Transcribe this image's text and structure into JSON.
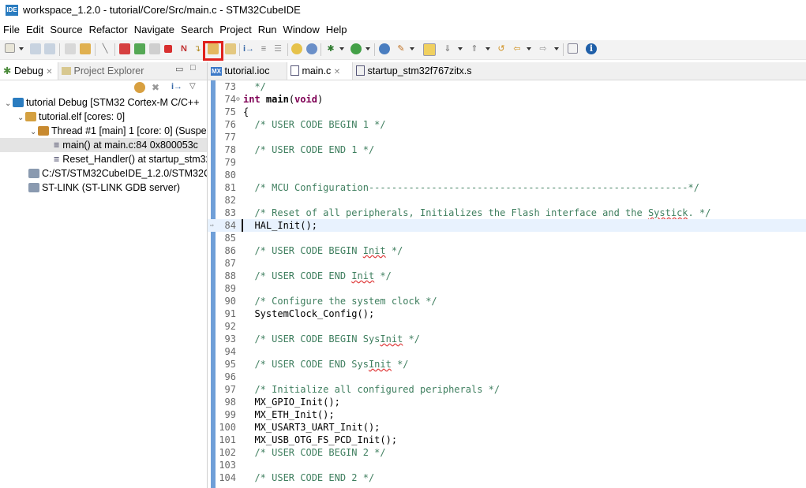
{
  "window": {
    "title": "workspace_1.2.0 - tutorial/Core/Src/main.c - STM32CubeIDE",
    "app_icon_text": "IDE"
  },
  "menu": [
    "File",
    "Edit",
    "Source",
    "Refactor",
    "Navigate",
    "Search",
    "Project",
    "Run",
    "Window",
    "Help"
  ],
  "colors": {
    "highlight_box": "#e0211d",
    "comment": "#3f7f5f",
    "keyword": "#7f0055",
    "current_line": "#e8f2fe",
    "gutter": "#6f9fd8"
  },
  "left_panel": {
    "tabs": {
      "debug": "Debug",
      "project_explorer": "Project Explorer"
    },
    "tree": [
      {
        "label": "tutorial Debug [STM32 Cortex-M C/C++"
      },
      {
        "label": "tutorial.elf [cores: 0]"
      },
      {
        "label": "Thread #1 [main] 1 [core: 0] (Suspe"
      },
      {
        "label": "main() at main.c:84 0x800053c"
      },
      {
        "label": "Reset_Handler() at startup_stm32"
      },
      {
        "label": "C:/ST/STM32CubeIDE_1.2.0/STM32Cub"
      },
      {
        "label": "ST-LINK (ST-LINK GDB server)"
      }
    ]
  },
  "editor": {
    "tabs": [
      {
        "label": "tutorial.ioc",
        "icon": "MX"
      },
      {
        "label": "main.c"
      },
      {
        "label": "startup_stm32f767zitx.s"
      }
    ],
    "lines": [
      {
        "n": "73",
        "text": "  */"
      },
      {
        "n": "74",
        "text": "int main(void)"
      },
      {
        "n": "75",
        "text": "{"
      },
      {
        "n": "76",
        "text": "  /* USER CODE BEGIN 1 */"
      },
      {
        "n": "77",
        "text": ""
      },
      {
        "n": "78",
        "text": "  /* USER CODE END 1 */"
      },
      {
        "n": "79",
        "text": ""
      },
      {
        "n": "80",
        "text": ""
      },
      {
        "n": "81",
        "text": "  /* MCU Configuration--------------------------------------------------------*/"
      },
      {
        "n": "82",
        "text": ""
      },
      {
        "n": "83",
        "text": "  /* Reset of all peripherals, Initializes the Flash interface and the Systick. */"
      },
      {
        "n": "84",
        "text": "  HAL_Init();"
      },
      {
        "n": "85",
        "text": ""
      },
      {
        "n": "86",
        "text": "  /* USER CODE BEGIN Init */"
      },
      {
        "n": "87",
        "text": ""
      },
      {
        "n": "88",
        "text": "  /* USER CODE END Init */"
      },
      {
        "n": "89",
        "text": ""
      },
      {
        "n": "90",
        "text": "  /* Configure the system clock */"
      },
      {
        "n": "91",
        "text": "  SystemClock_Config();"
      },
      {
        "n": "92",
        "text": ""
      },
      {
        "n": "93",
        "text": "  /* USER CODE BEGIN SysInit */"
      },
      {
        "n": "94",
        "text": ""
      },
      {
        "n": "95",
        "text": "  /* USER CODE END SysInit */"
      },
      {
        "n": "96",
        "text": ""
      },
      {
        "n": "97",
        "text": "  /* Initialize all configured peripherals */"
      },
      {
        "n": "98",
        "text": "  MX_GPIO_Init();"
      },
      {
        "n": "99",
        "text": "  MX_ETH_Init();"
      },
      {
        "n": "100",
        "text": "  MX_USART3_UART_Init();"
      },
      {
        "n": "101",
        "text": "  MX_USB_OTG_FS_PCD_Init();"
      },
      {
        "n": "102",
        "text": "  /* USER CODE BEGIN 2 */"
      },
      {
        "n": "103",
        "text": ""
      },
      {
        "n": "104",
        "text": "  /* USER CODE END 2 */"
      }
    ]
  }
}
